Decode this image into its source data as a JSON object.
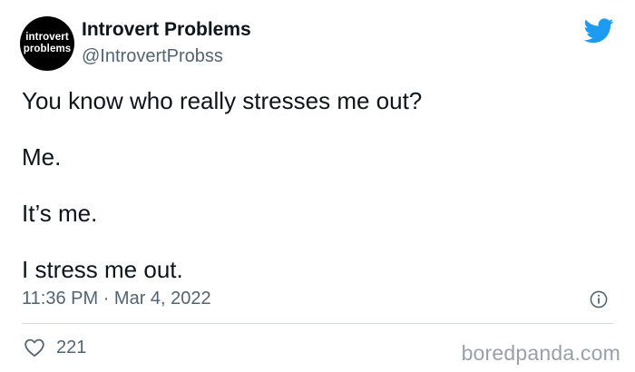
{
  "profile": {
    "avatar_line1": "introvert",
    "avatar_line2": "problems",
    "name": "Introvert Problems",
    "handle": "@IntrovertProbss"
  },
  "tweet": {
    "lines": [
      "You know who really stresses me out?",
      "Me.",
      "It’s me.",
      "I stress me out."
    ],
    "time": "11:36 PM",
    "separator": "·",
    "date": "Mar 4, 2022",
    "likes": "221"
  },
  "icons": {
    "brand": "twitter-bird-icon",
    "info": "info-icon",
    "like": "heart-icon"
  },
  "colors": {
    "brand": "#1d9bf0",
    "text": "#0f1419",
    "muted": "#536471",
    "divider": "#cfd9de"
  },
  "watermark": "boredpanda.com"
}
